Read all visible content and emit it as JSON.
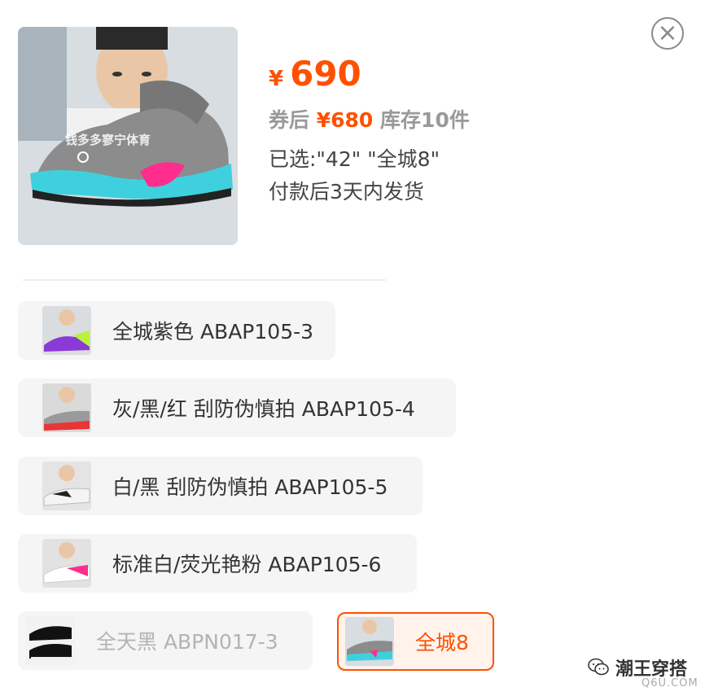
{
  "product": {
    "currency_symbol": "¥",
    "price": "690",
    "coupon_label": "券后",
    "coupon_price": "¥680",
    "stock_text": "库存10件",
    "selected_text": "已选:\"42\" \"全城8\"",
    "shipping_text": "付款后3天内发货",
    "image_caption": "钱多多寥宁体育"
  },
  "skus": [
    {
      "label": "全城紫色 ABAP105-3",
      "state": "normal",
      "accent": "#8a3ad6"
    },
    {
      "label": "灰/黑/红 刮防伪慎拍 ABAP105-4",
      "state": "normal",
      "accent": "#e83535"
    },
    {
      "label": "白/黑 刮防伪慎拍 ABAP105-5",
      "state": "normal",
      "accent": "#222222"
    },
    {
      "label": "标准白/荧光艳粉 ABAP105-6",
      "state": "normal",
      "accent": "#ff2d8d"
    },
    {
      "label": "全天黑 ABPN017-3",
      "state": "disabled",
      "accent": "#111111"
    },
    {
      "label": "全城8",
      "state": "selected",
      "accent": "#2ec4d6"
    }
  ],
  "watermark": {
    "name": "潮王穿搭",
    "site": "Q6U.COM"
  },
  "colors": {
    "accent": "#ff5000",
    "muted": "#999999",
    "chip_bg": "#f5f5f5"
  },
  "icons": {
    "close": "close-icon",
    "watermark": "wechat-icon"
  }
}
